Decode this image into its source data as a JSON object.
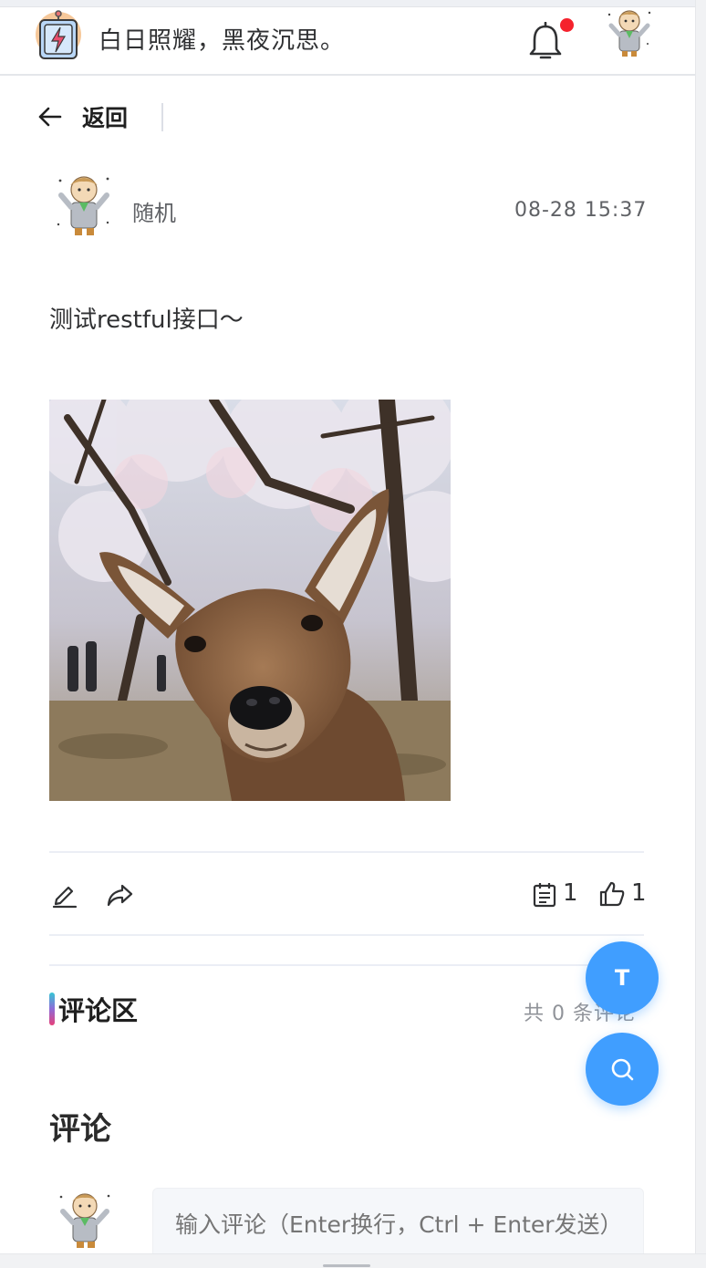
{
  "header": {
    "slogan": "白日照耀，黑夜沉思。",
    "notification_dot_color": "#f5222d"
  },
  "nav": {
    "back_label": "返回"
  },
  "post": {
    "author": "随机",
    "time": "08-28 15:37",
    "content": "测试restful接口～",
    "image_subject": "deer under cherry blossom trees",
    "comment_count": "1",
    "like_count": "1"
  },
  "comments": {
    "section_title": "评论区",
    "total_text": "共 0 条评论",
    "heading": "评论",
    "input_placeholder": "输入评论（Enter换行，Ctrl + Enter发送）"
  },
  "fab": {
    "top_label": "T",
    "accent_color": "#409eff"
  }
}
